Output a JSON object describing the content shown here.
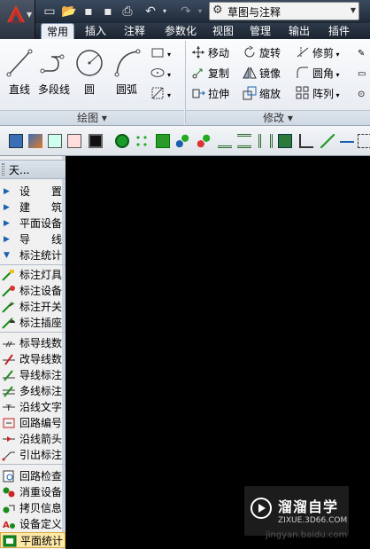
{
  "app": {
    "workspace_label": "草图与注释"
  },
  "ribbon_tabs": [
    "常用",
    "插入",
    "注释",
    "参数化",
    "视图",
    "管理",
    "输出",
    "插件"
  ],
  "draw_panel": {
    "title": "绘图",
    "tools": [
      "直线",
      "多段线",
      "圆",
      "圆弧"
    ]
  },
  "modify_panel": {
    "title": "修改",
    "rows": [
      [
        "移动",
        "旋转",
        "修剪"
      ],
      [
        "复制",
        "镜像",
        "圆角"
      ],
      [
        "拉伸",
        "缩放",
        "阵列"
      ]
    ]
  },
  "left_panel": {
    "header": "天...",
    "categories": [
      {
        "label": "设　　置",
        "expanded": false
      },
      {
        "label": "建　　筑",
        "expanded": false
      },
      {
        "label": "平面设备",
        "expanded": false
      },
      {
        "label": "导　　线",
        "expanded": false
      },
      {
        "label": "标注统计",
        "expanded": true
      }
    ],
    "group1": [
      "标注灯具",
      "标注设备",
      "标注开关",
      "标注插座"
    ],
    "group2": [
      "标导线数",
      "改导线数",
      "导线标注",
      "多线标注",
      "沿线文字",
      "回路编号",
      "沿线箭头",
      "引出标注"
    ],
    "group3": [
      "回路检查",
      "消重设备",
      "拷贝信息",
      "设备定义",
      "平面统计"
    ],
    "active_item": "平面统计"
  },
  "watermark": {
    "title": "溜溜自学",
    "subtitle": "ZIXUE.3D66.COM",
    "url": "jingyan.baidu.com"
  }
}
